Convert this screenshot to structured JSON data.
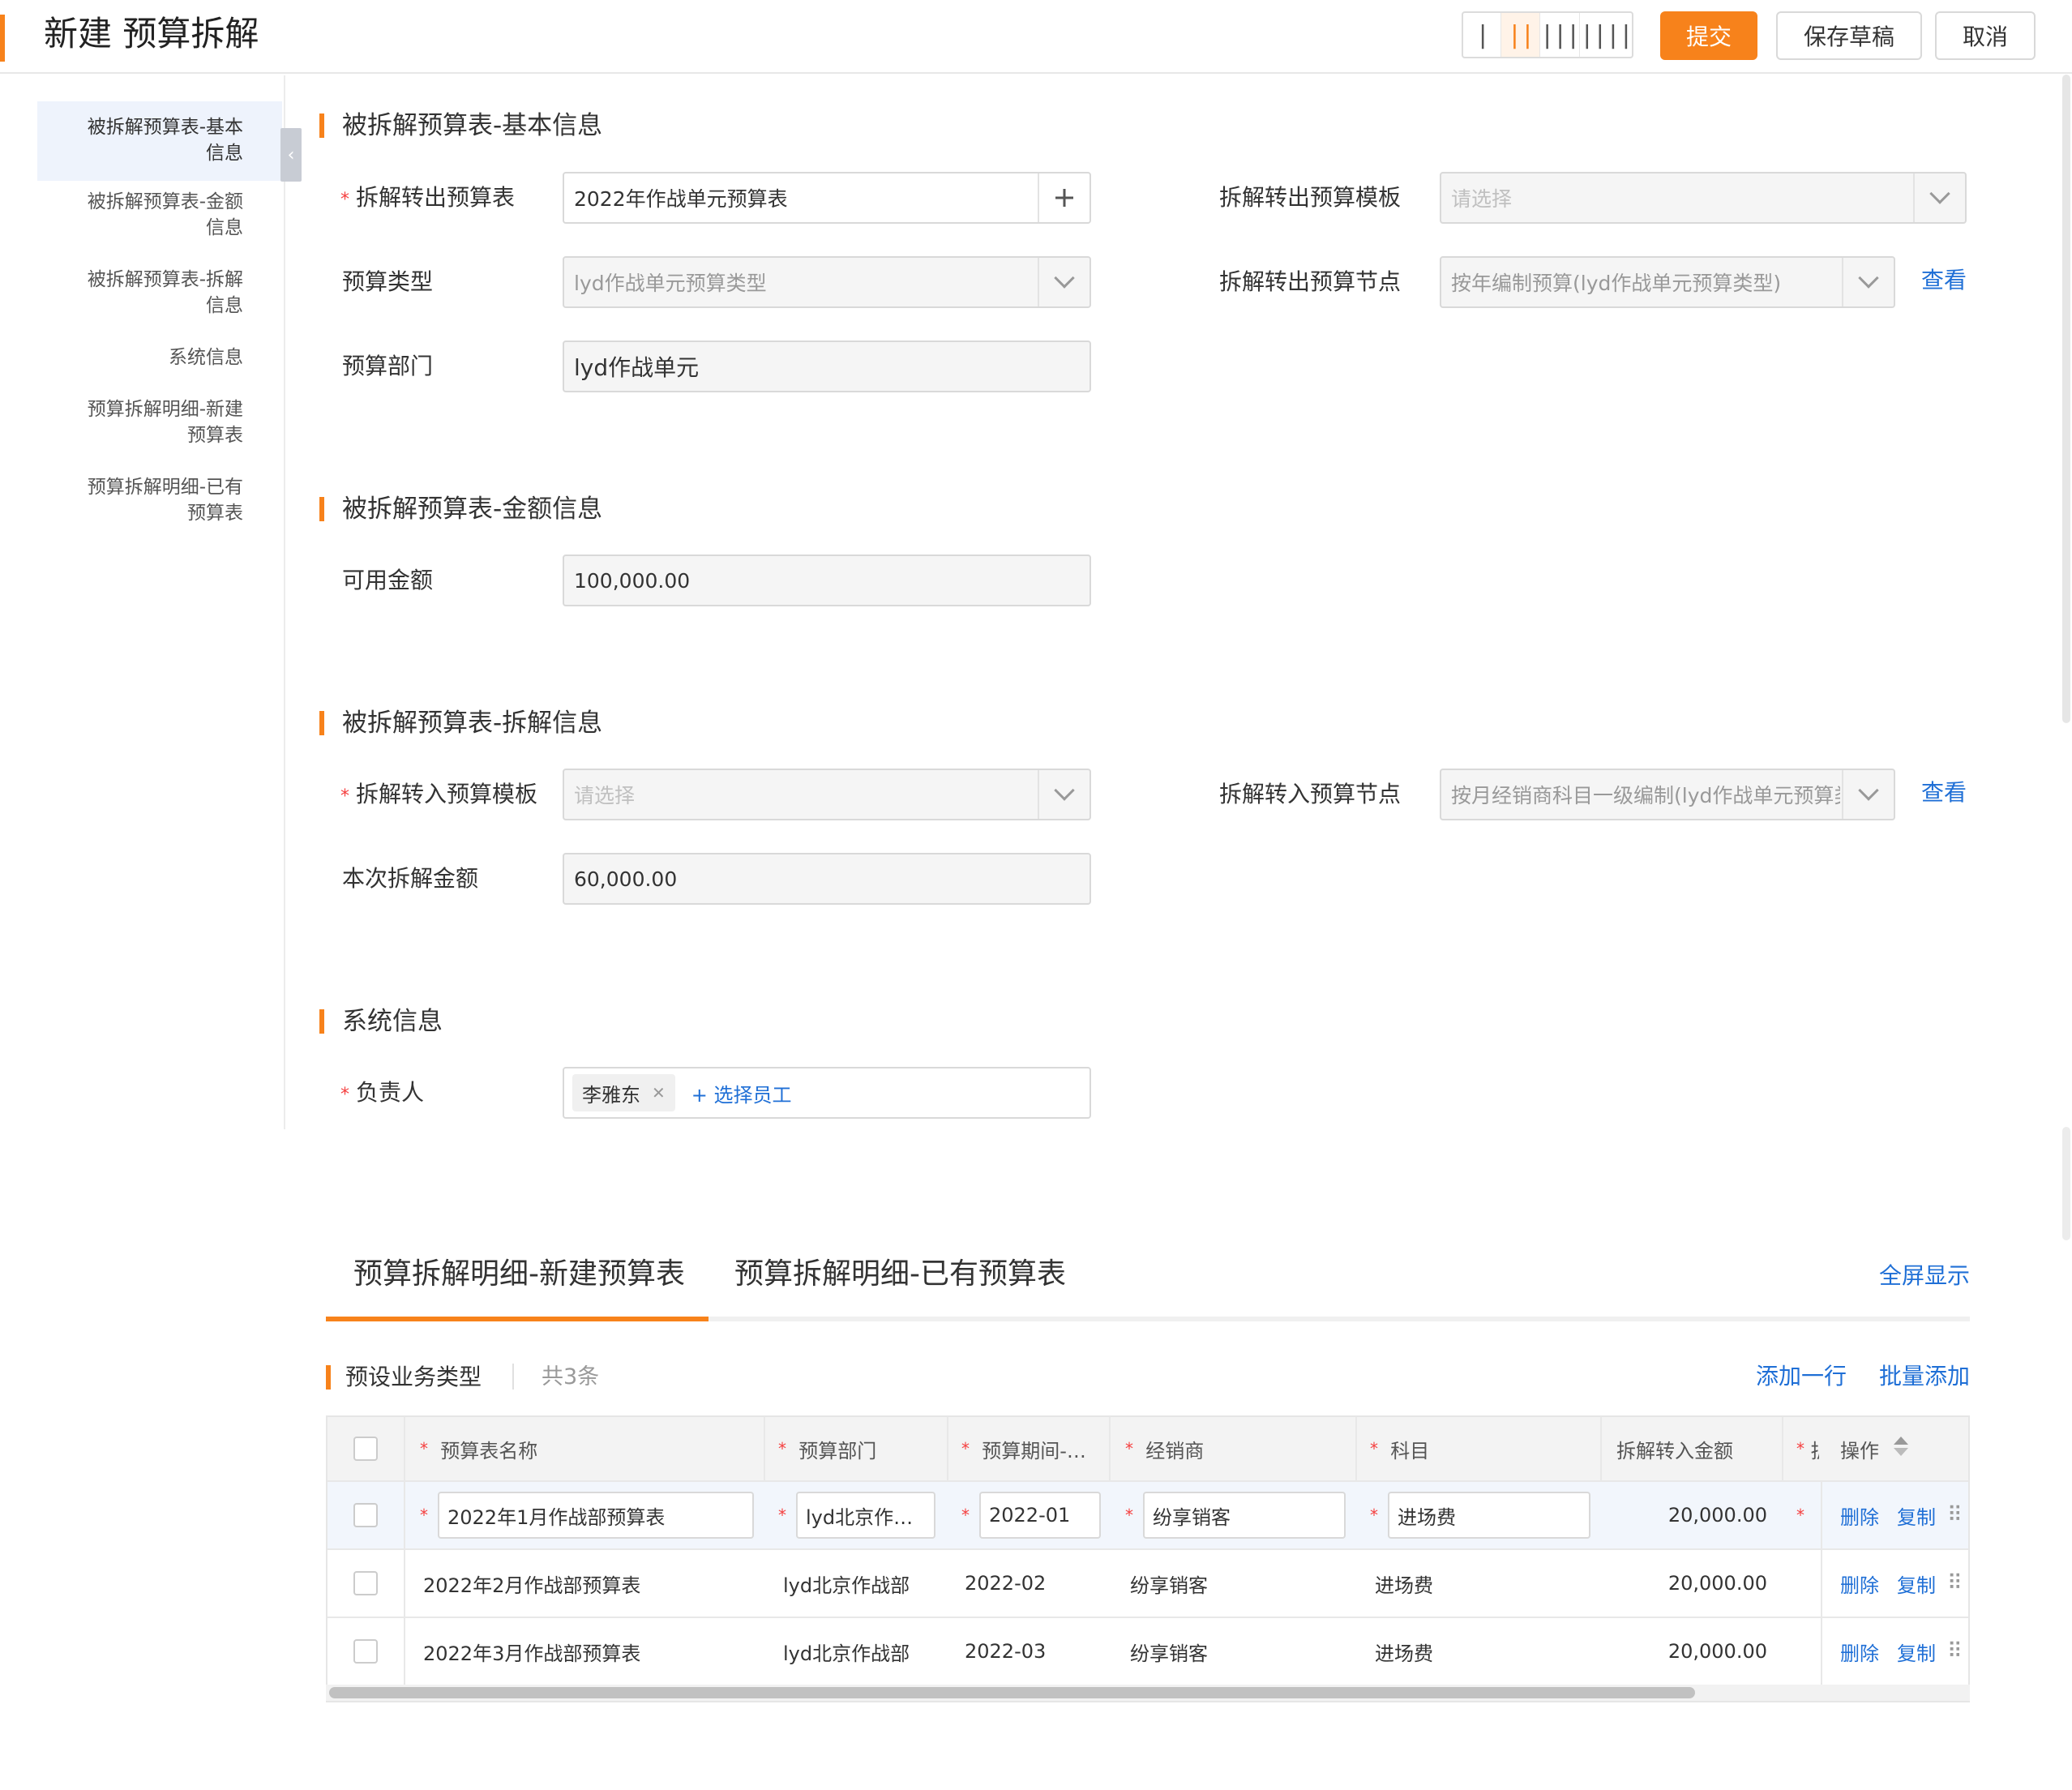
{
  "header": {
    "title": "新建 预算拆解",
    "column_switch": [
      "Ⅰ",
      "Ⅱ",
      "Ⅲ",
      "Ⅳ"
    ],
    "column_switch_active": 1,
    "submit_label": "提交",
    "save_draft_label": "保存草稿",
    "cancel_label": "取消"
  },
  "sidenav": {
    "items": [
      {
        "label": "被拆解预算表-基本信息",
        "line1": "被拆解预算表-基本",
        "line2": "信息"
      },
      {
        "label": "被拆解预算表-金额信息",
        "line1": "被拆解预算表-金额",
        "line2": "信息"
      },
      {
        "label": "被拆解预算表-拆解信息",
        "line1": "被拆解预算表-拆解",
        "line2": "信息"
      },
      {
        "label": "系统信息",
        "line1": "系统信息",
        "line2": ""
      },
      {
        "label": "预算拆解明细-新建预算表",
        "line1": "预算拆解明细-新建",
        "line2": "预算表"
      },
      {
        "label": "预算拆解明细-已有预算表",
        "line1": "预算拆解明细-已有",
        "line2": "预算表"
      }
    ],
    "collapse_icon": "‹"
  },
  "basic": {
    "title": "被拆解预算表-基本信息",
    "out_table_label": "拆解转出预算表",
    "out_table_value": "2022年作战单元预算表",
    "out_template_label": "拆解转出预算模板",
    "out_template_placeholder": "请选择",
    "type_label": "预算类型",
    "type_value": "lyd作战单元预算类型",
    "out_node_label": "拆解转出预算节点",
    "out_node_value": "按年编制预算(lyd作战单元预算类型)",
    "view_label": "查看",
    "dept_label": "预算部门",
    "dept_value": "lyd作战单元"
  },
  "amount": {
    "title": "被拆解预算表-金额信息",
    "available_label": "可用金额",
    "available_value": "100,000.00"
  },
  "split": {
    "title": "被拆解预算表-拆解信息",
    "in_template_label": "拆解转入预算模板",
    "in_template_placeholder": "请选择",
    "in_node_label": "拆解转入预算节点",
    "in_node_value": "按月经销商科目一级编制(lyd作战单元预算类",
    "view_label": "查看",
    "split_amount_label": "本次拆解金额",
    "split_amount_value": "60,000.00"
  },
  "system": {
    "title": "系统信息",
    "owner_label": "负责人",
    "owner_tag": "李雅东",
    "select_employee": "+ 选择员工"
  },
  "tabs": {
    "tab1": "预算拆解明细-新建预算表",
    "tab2": "预算拆解明细-已有预算表",
    "fullscreen": "全屏显示"
  },
  "table_toolbar": {
    "title": "预设业务类型",
    "count": "共3条",
    "add_row": "添加一行",
    "batch_add": "批量添加"
  },
  "table": {
    "headers": {
      "name": "预算表名称",
      "dept": "预算部门",
      "period": "预算期间-…",
      "dealer": "经销商",
      "subject": "科目",
      "amount": "拆解转入金额",
      "extra": "拆",
      "ops": "操作"
    },
    "rows": [
      {
        "name": "2022年1月作战部预算表",
        "dept": "lyd北京作…",
        "period": "2022-01",
        "dealer": "纷享销客",
        "subject": "进场费",
        "amount": "20,000.00",
        "delete": "删除",
        "copy": "复制"
      },
      {
        "name": "2022年2月作战部预算表",
        "dept": "lyd北京作战部",
        "period": "2022-02",
        "dealer": "纷享销客",
        "subject": "进场费",
        "amount": "20,000.00",
        "delete": "删除",
        "copy": "复制"
      },
      {
        "name": "2022年3月作战部预算表",
        "dept": "lyd北京作战部",
        "period": "2022-03",
        "dealer": "纷享销客",
        "subject": "进场费",
        "amount": "20,000.00",
        "delete": "删除",
        "copy": "复制"
      }
    ]
  },
  "icons": {
    "plus": "plus-icon",
    "chevron": "chevron-down-icon",
    "close": "close-icon",
    "drag": "drag-handle-icon",
    "sort": "sort-icon"
  },
  "colors": {
    "accent": "#f7821b",
    "link": "#1f6fd6",
    "required": "#f53f3f"
  }
}
